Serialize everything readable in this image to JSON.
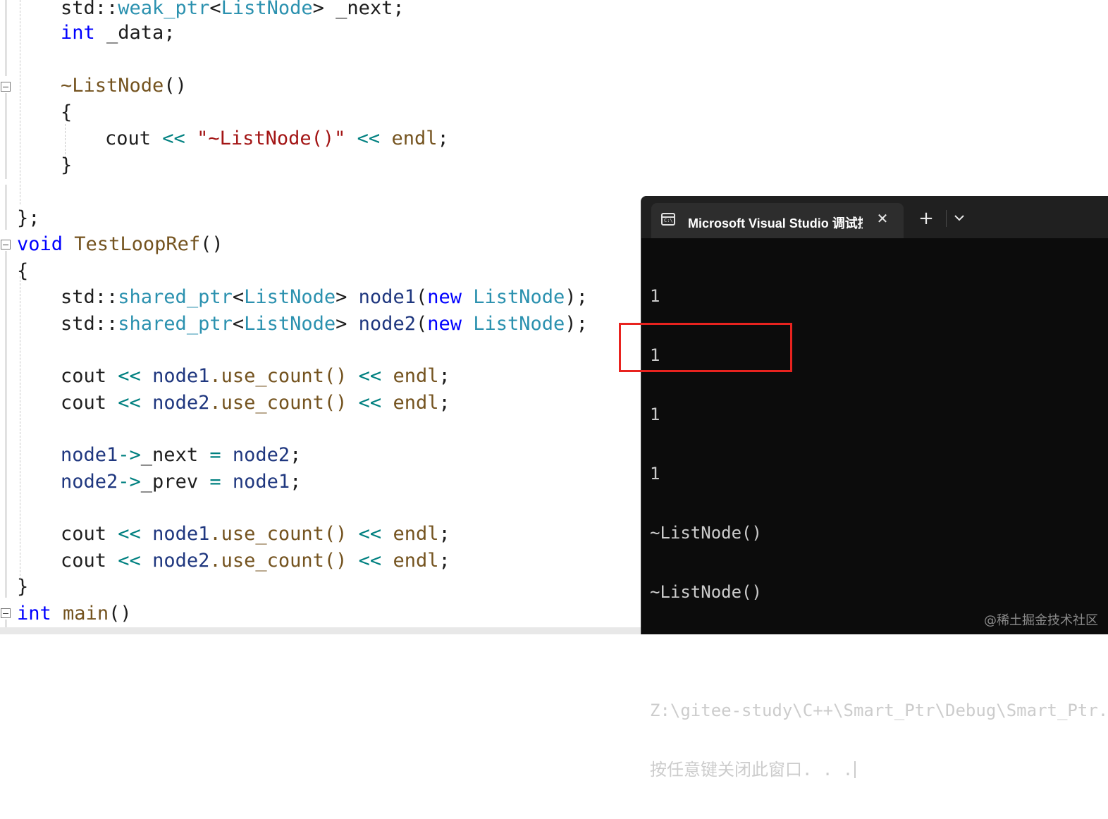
{
  "editor": {
    "lines": [
      [
        [
          "std::",
          "punc"
        ],
        [
          "weak_ptr",
          "ty"
        ],
        [
          "<",
          "punc"
        ],
        [
          "ListNode",
          "ty"
        ],
        [
          "> _next;",
          "punc"
        ]
      ],
      [
        [
          "int",
          "kw"
        ],
        [
          " _data;",
          "punc"
        ]
      ],
      [
        [
          "~ListNode",
          "fn"
        ],
        [
          "()",
          "punc"
        ]
      ],
      [
        [
          "{",
          "punc"
        ]
      ],
      [
        [
          "cout ",
          "punc"
        ],
        [
          "<<",
          "op"
        ],
        [
          " ",
          "punc"
        ],
        [
          "\"~ListNode()\"",
          "str"
        ],
        [
          " ",
          "punc"
        ],
        [
          "<<",
          "op"
        ],
        [
          " ",
          "punc"
        ],
        [
          "endl",
          "fn"
        ],
        [
          ";",
          "punc"
        ]
      ],
      [
        [
          "}",
          "punc"
        ]
      ],
      [
        [
          "};",
          "punc"
        ]
      ],
      [
        [
          "void",
          "kw"
        ],
        [
          " ",
          "punc"
        ],
        [
          "TestLoopRef",
          "fn"
        ],
        [
          "()",
          "punc"
        ]
      ],
      [
        [
          "{",
          "punc"
        ]
      ],
      [
        [
          "std::",
          "punc"
        ],
        [
          "shared_ptr",
          "ty"
        ],
        [
          "<",
          "punc"
        ],
        [
          "ListNode",
          "ty"
        ],
        [
          "> ",
          "punc"
        ],
        [
          "node1",
          "var"
        ],
        [
          "(",
          "punc"
        ],
        [
          "new",
          "kw"
        ],
        [
          " ",
          "punc"
        ],
        [
          "ListNode",
          "ty"
        ],
        [
          ");",
          "punc"
        ]
      ],
      [
        [
          "std::",
          "punc"
        ],
        [
          "shared_ptr",
          "ty"
        ],
        [
          "<",
          "punc"
        ],
        [
          "ListNode",
          "ty"
        ],
        [
          "> ",
          "punc"
        ],
        [
          "node2",
          "var"
        ],
        [
          "(",
          "punc"
        ],
        [
          "new",
          "kw"
        ],
        [
          " ",
          "punc"
        ],
        [
          "ListNode",
          "ty"
        ],
        [
          ");",
          "punc"
        ]
      ],
      [
        [
          "cout ",
          "punc"
        ],
        [
          "<<",
          "op"
        ],
        [
          " ",
          "punc"
        ],
        [
          "node1",
          "var"
        ],
        [
          ".use_count() ",
          "fn"
        ],
        [
          "<<",
          "op"
        ],
        [
          " ",
          "punc"
        ],
        [
          "endl",
          "fn"
        ],
        [
          ";",
          "punc"
        ]
      ],
      [
        [
          "cout ",
          "punc"
        ],
        [
          "<<",
          "op"
        ],
        [
          " ",
          "punc"
        ],
        [
          "node2",
          "var"
        ],
        [
          ".use_count() ",
          "fn"
        ],
        [
          "<<",
          "op"
        ],
        [
          " ",
          "punc"
        ],
        [
          "endl",
          "fn"
        ],
        [
          ";",
          "punc"
        ]
      ],
      [
        [
          "node1",
          "var"
        ],
        [
          "->",
          "op"
        ],
        [
          "_next ",
          "punc"
        ],
        [
          "=",
          "op"
        ],
        [
          " ",
          "punc"
        ],
        [
          "node2",
          "var"
        ],
        [
          ";",
          "punc"
        ]
      ],
      [
        [
          "node2",
          "var"
        ],
        [
          "->",
          "op"
        ],
        [
          "_prev ",
          "punc"
        ],
        [
          "=",
          "op"
        ],
        [
          " ",
          "punc"
        ],
        [
          "node1",
          "var"
        ],
        [
          ";",
          "punc"
        ]
      ],
      [
        [
          "cout ",
          "punc"
        ],
        [
          "<<",
          "op"
        ],
        [
          " ",
          "punc"
        ],
        [
          "node1",
          "var"
        ],
        [
          ".use_count() ",
          "fn"
        ],
        [
          "<<",
          "op"
        ],
        [
          " ",
          "punc"
        ],
        [
          "endl",
          "fn"
        ],
        [
          ";",
          "punc"
        ]
      ],
      [
        [
          "cout ",
          "punc"
        ],
        [
          "<<",
          "op"
        ],
        [
          " ",
          "punc"
        ],
        [
          "node2",
          "var"
        ],
        [
          ".use_count() ",
          "fn"
        ],
        [
          "<<",
          "op"
        ],
        [
          " ",
          "punc"
        ],
        [
          "endl",
          "fn"
        ],
        [
          ";",
          "punc"
        ]
      ],
      [
        [
          "}",
          "punc"
        ]
      ],
      [
        [
          "int",
          "kw"
        ],
        [
          " ",
          "punc"
        ],
        [
          "main",
          "fn"
        ],
        [
          "()",
          "punc"
        ]
      ]
    ]
  },
  "terminal": {
    "tab_title": "Microsoft Visual Studio 调试控制台",
    "tab_icon_text": "C:\\",
    "close_glyph": "✕",
    "new_tab_glyph": "+",
    "output_lines": [
      "1",
      "1",
      "1",
      "1",
      "~ListNode()",
      "~ListNode()",
      "",
      "Z:\\gitee-study\\C++\\Smart_Ptr\\Debug\\Smart_Ptr.exe",
      "按任意键关闭此窗口. . ."
    ]
  },
  "watermark": "@稀土掘金技术社区",
  "colors": {
    "keyword": "#0000ff",
    "type": "#2b91af",
    "function": "#74531f",
    "variable": "#1f377f",
    "operator": "#008080",
    "string": "#a31515",
    "highlight_box": "#e8231f",
    "terminal_bg": "#0c0c0c"
  }
}
